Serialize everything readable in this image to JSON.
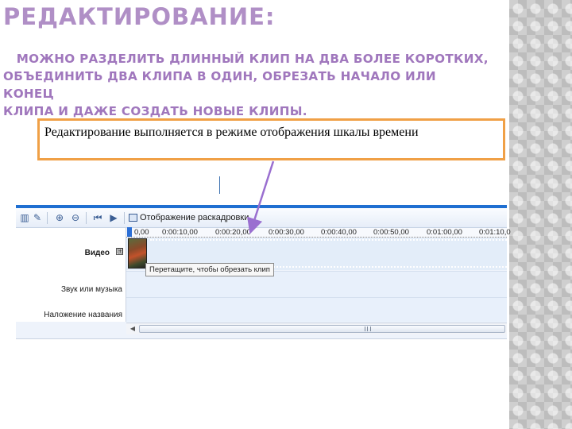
{
  "slide": {
    "title": "РЕДАКТИРОВАНИЕ:",
    "subtitle_line1": "   МОЖНО РАЗДЕЛИТЬ ДЛИННЫЙ КЛИП НА ДВА БОЛЕЕ КОРОТКИХ,",
    "subtitle_line2": "ОБЪЕДИНИТЬ ДВА КЛИПА В ОДИН, ОБРЕЗАТЬ НАЧАЛО ИЛИ КОНЕЦ",
    "subtitle_line3": "КЛИПА И ДАЖЕ СОЗДАТЬ НОВЫЕ КЛИПЫ.",
    "callout_text": "Редактирование выполняется в режиме отображения шкалы времени",
    "colors": {
      "title": "#b08fc6",
      "subtitle": "#a077bd",
      "callout_border": "#f0a046",
      "arrow": "#9a6fd0"
    }
  },
  "timeline": {
    "toolbar": {
      "storyboard_label": "Отображение раскадровки.",
      "icons": [
        "narrate-icon",
        "audio-levels-icon",
        "zoom-in-icon",
        "zoom-out-icon",
        "rewind-icon",
        "play-icon",
        "storyboard-icon"
      ]
    },
    "ruler_ticks": [
      "0,00",
      "0:00:10,00",
      "0:00:20,00",
      "0:00:30,00",
      "0:00:40,00",
      "0:00:50,00",
      "0:01:00,00",
      "0:01:10,0"
    ],
    "tracks": {
      "video": "Видео",
      "audio": "Звук или музыка",
      "title_overlay": "Наложение названия"
    },
    "expand_symbol": "⊞",
    "tooltip": "Перетащите, чтобы обрезать клип"
  }
}
